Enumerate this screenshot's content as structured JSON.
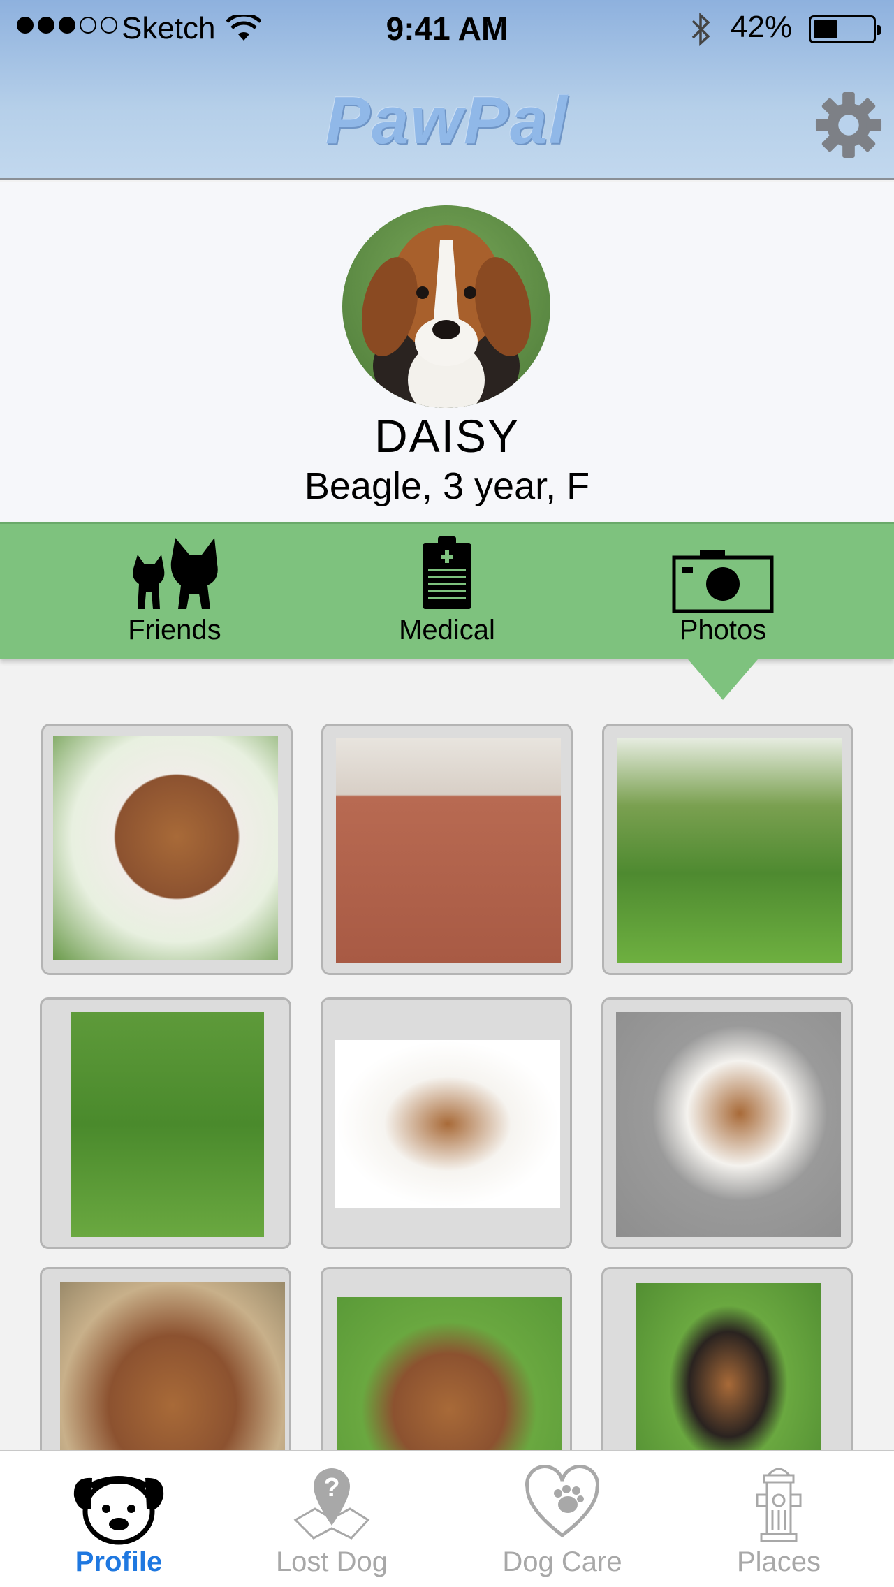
{
  "status_bar": {
    "carrier": "Sketch",
    "time": "9:41 AM",
    "battery_percent": "42%",
    "battery_level": 0.42,
    "signal_bars_filled": 3,
    "signal_bars_total": 5
  },
  "header": {
    "title": "PawPal",
    "settings_icon": "gear-icon"
  },
  "profile": {
    "name": "DAISY",
    "details": "Beagle, 3 year, F"
  },
  "tabs": [
    {
      "label": "Friends",
      "icon": "cat-dog-icon",
      "selected": false
    },
    {
      "label": "Medical",
      "icon": "clipboard-icon",
      "selected": false
    },
    {
      "label": "Photos",
      "icon": "camera-icon",
      "selected": true
    }
  ],
  "photos_count": 9,
  "bottom_nav": [
    {
      "label": "Profile",
      "icon": "dog-face-icon",
      "active": true
    },
    {
      "label": "Lost Dog",
      "icon": "map-marker-question-icon",
      "active": false
    },
    {
      "label": "Dog Care",
      "icon": "heart-paw-icon",
      "active": false
    },
    {
      "label": "Places",
      "icon": "fire-hydrant-icon",
      "active": false
    }
  ],
  "colors": {
    "header_top": "#8eb1de",
    "tab_bar": "#7ec27e",
    "active_nav": "#1f78e0",
    "inactive_nav": "#a8a8a8"
  }
}
